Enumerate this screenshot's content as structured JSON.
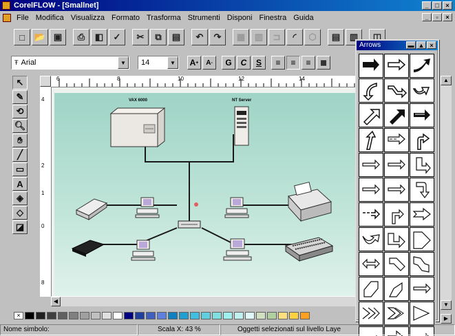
{
  "window": {
    "title": "CorelFLOW - [Smallnet]"
  },
  "menu": [
    "File",
    "Modifica",
    "Visualizza",
    "Formato",
    "Trasforma",
    "Strumenti",
    "Disponi",
    "Finestra",
    "Guida"
  ],
  "toolbar": {
    "icons": [
      "new-icon",
      "open-icon",
      "save-icon",
      "print-icon",
      "print-preview-icon",
      "spellcheck-icon",
      "cut-icon",
      "copy-icon",
      "paste-icon",
      "undo-icon",
      "redo-icon",
      "group-icon",
      "ungroup-icon",
      "connector-icon",
      "curve-icon",
      "shape-icon",
      "align-icon",
      "distribute-icon",
      "window-icon"
    ]
  },
  "format": {
    "font": "Arial",
    "size": "14",
    "bold": "G",
    "italic": "C",
    "underline": "S",
    "grow": "A",
    "shrink": "A"
  },
  "tools": [
    "pointer-icon",
    "node-edit-icon",
    "rotate-icon",
    "zoom-icon",
    "pan-icon",
    "line-icon",
    "rectangle-icon",
    "text-icon",
    "fill-icon",
    "outline-icon",
    "shadow-icon"
  ],
  "ruler": {
    "h_labels": [
      "6",
      "8",
      "10",
      "12",
      "14"
    ],
    "v_labels": [
      "4",
      "2",
      "1",
      "0",
      "8"
    ]
  },
  "diagram": {
    "labels": {
      "server1": "VAX 6000",
      "server2": "NT Server"
    }
  },
  "palette": [
    "#000000",
    "#202020",
    "#404040",
    "#606060",
    "#808080",
    "#a0a0a0",
    "#c0c0c0",
    "#e0e0e0",
    "#ffffff",
    "#000080",
    "#2040a0",
    "#4060c0",
    "#6080e0",
    "#1080c0",
    "#20a0d0",
    "#40c0e0",
    "#60d0e0",
    "#80e0e0",
    "#a0f0f0",
    "#c0f0f0",
    "#e0f8f8",
    "#d0e0c0",
    "#b0d0a0",
    "#ffe080",
    "#ffd040",
    "#ffa020"
  ],
  "status": {
    "left": "Nome simbolo:",
    "middle": "Scala X: 43 %",
    "right": "Oggetti selezionati sul livello Laye"
  },
  "arrows_window": {
    "title": "Arrows"
  }
}
